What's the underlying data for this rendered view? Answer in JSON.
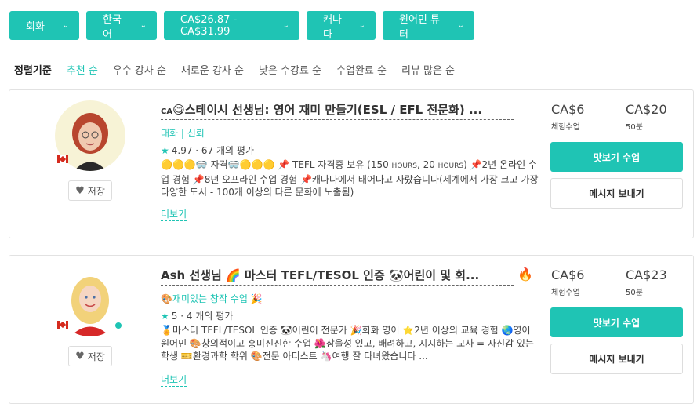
{
  "filters": [
    {
      "label": "회화"
    },
    {
      "label": "한국어"
    },
    {
      "label": "CA$26.87 - CA$31.99"
    },
    {
      "label": "캐나다"
    },
    {
      "label": "원어민 튜터"
    }
  ],
  "sort": {
    "label": "정렬기준",
    "options": [
      "추천 순",
      "우수 강사 순",
      "새로운 강사 순",
      "낮은 수강료 순",
      "수업완료 순",
      "리뷰 많은 순"
    ]
  },
  "tutors": [
    {
      "country_code": "CA",
      "title": "😋스테이시 선생님: 영어 재미 만들기(ESL / EFL 전문화) ...",
      "tagline": "대화 | 신뢰",
      "rating": "4.97 · 67 개의 평가",
      "desc_part1": "🟡🟡🟡🥽 자격🥽🟡🟡🟡 📌 TEFL 자격증 보유 (150 ",
      "desc_hours": "HOURS",
      "desc_part2": ", 20 ",
      "desc_part3": ") 📌2년 온라인 수업 경험 📌8년 오프라인 수업 경험 📌캐나다에서 태어나고 자랐습니다(세계에서 가장 크고 가장 다양한 도시 - 100개 이상의 다른 문화에 노출됨)",
      "more": "더보기",
      "save": "저장",
      "trial_price": "CA$6",
      "trial_label": "체험수업",
      "price": "CA$20",
      "price_label": "50분",
      "trial_button": "맛보기 수업",
      "message_button": "메시지 보내기"
    },
    {
      "title": "Ash 선생님 🌈 마스터 TEFL/TESOL 인증 🐼어린이 및 회...",
      "fire": "🔥",
      "tagline": "🎨재미있는 창작 수업 🎉",
      "rating": "5 · 4 개의 평가",
      "desc": "🏅마스터 TEFL/TESOL 인증 🐼어린이 전문가 🎉회화 영어 ⭐2년 이상의 교육 경험 🌏영어 원어민 🎨창의적이고 흥미진진한 수업 🌺참을성 있고, 배려하고, 지지하는 교사 = 자신감 있는 학생 🎫환경과학 학위 🎨전문 아티스트 🦄여행 잘 다녀왔습니다 ...",
      "more": "더보기",
      "save": "저장",
      "trial_price": "CA$6",
      "trial_label": "체험수업",
      "price": "CA$23",
      "price_label": "50분",
      "trial_button": "맛보기 수업",
      "message_button": "메시지 보내기"
    }
  ],
  "colors": {
    "accent": "#1fc4b4"
  }
}
